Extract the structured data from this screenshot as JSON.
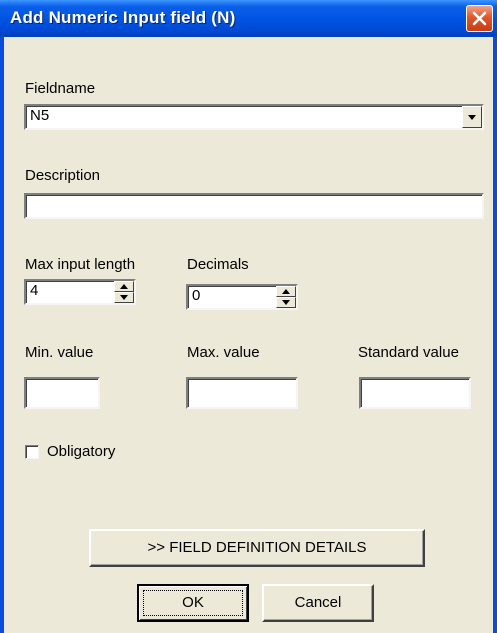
{
  "window": {
    "title": "Add Numeric Input field (N)"
  },
  "fieldname": {
    "label": "Fieldname",
    "value": "N5"
  },
  "description": {
    "label": "Description",
    "value": ""
  },
  "max_input_length": {
    "label": "Max input length",
    "value": "4"
  },
  "decimals": {
    "label": "Decimals",
    "value": "0"
  },
  "min_value": {
    "label": "Min. value",
    "value": ""
  },
  "max_value": {
    "label": "Max. value",
    "value": ""
  },
  "standard_value": {
    "label": "Standard value",
    "value": ""
  },
  "obligatory": {
    "label": "Obligatory",
    "checked": false
  },
  "buttons": {
    "details": ">> FIELD DEFINITION DETAILS",
    "ok": "OK",
    "cancel": "Cancel"
  },
  "icons": {
    "close": "close-icon",
    "dropdown": "chevron-down-icon",
    "spin_up": "spin-up-icon",
    "spin_down": "spin-down-icon"
  },
  "colors": {
    "titlebar": "#0054e3",
    "window_bg": "#ece9d8",
    "close_button": "#e0572c"
  }
}
